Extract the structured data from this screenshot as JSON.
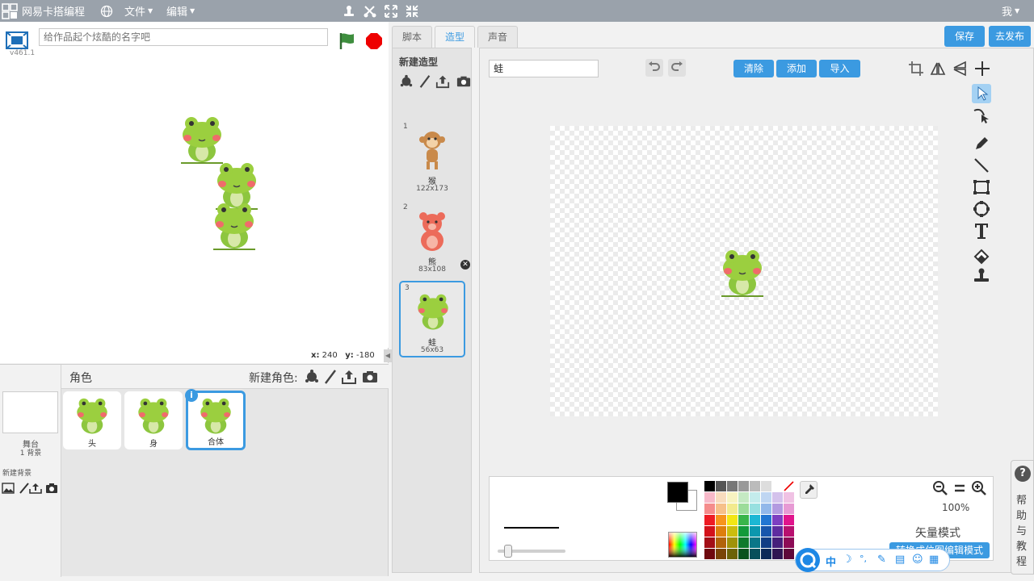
{
  "topbar": {
    "brand": "网易卡搭编程",
    "menu_file": "文件",
    "menu_edit": "编辑",
    "user": "我"
  },
  "stage": {
    "version": "v461.1",
    "title_placeholder": "给作品起个炫酷的名字吧",
    "x_label": "x:",
    "x_value": "240",
    "y_label": "y:",
    "y_value": "-180"
  },
  "sprites": {
    "title": "角色",
    "new_sprite": "新建角色:",
    "stage_name": "舞台",
    "stage_bg_count": "1 背景",
    "new_backdrop": "新建背景",
    "items": [
      {
        "name": "头"
      },
      {
        "name": "身"
      },
      {
        "name": "合体"
      }
    ],
    "info_glyph": "i"
  },
  "tabs": [
    {
      "label": "脚本"
    },
    {
      "label": "造型"
    },
    {
      "label": "声音"
    }
  ],
  "actions": {
    "save": "保存",
    "publish": "去发布"
  },
  "costumes": {
    "title": "新建造型",
    "items": [
      {
        "num": "1",
        "name": "猴",
        "size": "122x173"
      },
      {
        "num": "2",
        "name": "熊",
        "size": "83x108"
      },
      {
        "num": "3",
        "name": "蛙",
        "size": "56x63"
      }
    ]
  },
  "editor": {
    "costume_name": "蛙",
    "clear": "清除",
    "add": "添加",
    "import": "导入",
    "zoom": "100%",
    "mode_label": "矢量模式",
    "mode_button": "转换成位图编辑模式"
  },
  "palette": [
    "#000000",
    "#555555",
    "#777777",
    "#999999",
    "#bbbbbb",
    "#dddddd",
    "#ffffff",
    "#ffffff",
    "#f7b9c9",
    "#f8dcbe",
    "#f7f3c1",
    "#c5e9c3",
    "#c4ecec",
    "#bfd6f2",
    "#d4c2ec",
    "#f0c2e4",
    "#f58c8c",
    "#f6c08a",
    "#f2ea8e",
    "#9cdc9a",
    "#97e0e0",
    "#92b8ea",
    "#b39ae0",
    "#e79ad4",
    "#ee1c24",
    "#f7941d",
    "#f2e614",
    "#39b54a",
    "#1cb7d4",
    "#2176d2",
    "#7d3fc1",
    "#e0148c",
    "#d3121b",
    "#de7e0d",
    "#cbbd0e",
    "#139a3b",
    "#0b97ae",
    "#1756ac",
    "#5f2ca0",
    "#b8106f",
    "#a30f17",
    "#b2630b",
    "#9f920a",
    "#0e7a2d",
    "#0a7688",
    "#113e85",
    "#46207a",
    "#8d0c56",
    "#6f0a0f",
    "#7a4407",
    "#6c6307",
    "#09521e",
    "#074f5b",
    "#0b2a59",
    "#2f1552",
    "#5f083a"
  ],
  "help": {
    "glyph": "?",
    "text": "帮助与教程"
  },
  "ime": {
    "zh": "中",
    "punct": "°,"
  }
}
